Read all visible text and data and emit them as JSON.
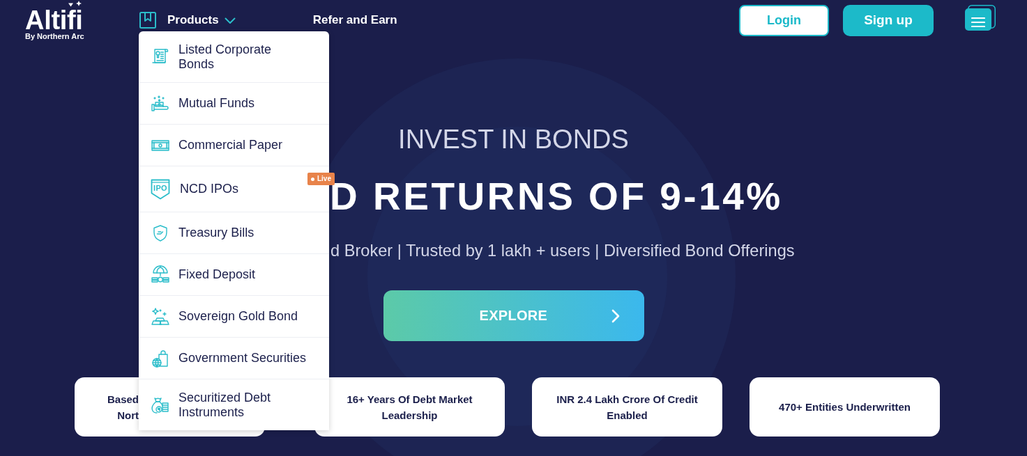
{
  "header": {
    "logo": {
      "wordmark": "Altifi",
      "tagline": "By Northern Arc"
    },
    "products": {
      "label": "Products",
      "expanded": true,
      "items": [
        {
          "label": "Listed Corporate Bonds"
        },
        {
          "label": "Mutual Funds"
        },
        {
          "label": "Commercial Paper"
        },
        {
          "label": "NCD IPOs",
          "icon_label": "IPO",
          "badge": "Live"
        },
        {
          "label": "Treasury Bills"
        },
        {
          "label": "Fixed Deposit"
        },
        {
          "label": "Sovereign Gold Bond"
        },
        {
          "label": "Government Securities"
        },
        {
          "label": "Securitized Debt Instruments"
        }
      ]
    },
    "refer_link": "Refer and Earn",
    "login_button": "Login",
    "signup_button": "Sign up"
  },
  "hero": {
    "eyebrow": "INVEST IN BONDS",
    "heading": "D RETURNS OF 9-14%",
    "subtitle": "d Broker | Trusted by 1 lakh + users | Diversified Bond Offerings",
    "cta": "EXPLORE"
  },
  "highlights": [
    {
      "text": "Based Nort"
    },
    {
      "text": "16+ Years Of Debt Market Leadership"
    },
    {
      "text": "INR 2.4 Lakh Crore Of Credit Enabled"
    },
    {
      "text": "470+ Entities Underwritten"
    }
  ]
}
